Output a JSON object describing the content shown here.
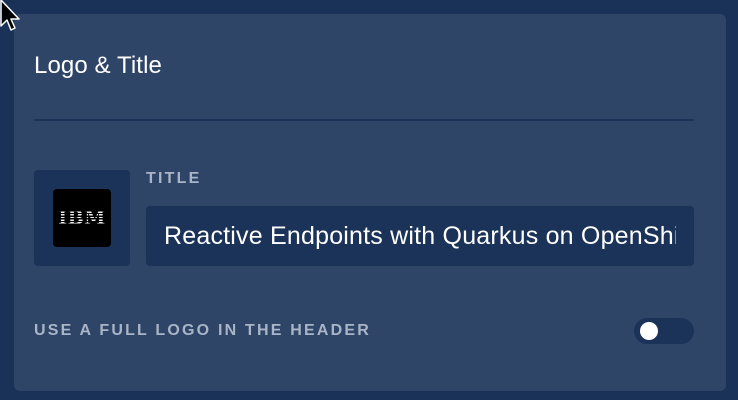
{
  "panel": {
    "title": "Logo & Title"
  },
  "logo": {
    "icon": "ibm-logo",
    "text": "IBM"
  },
  "title_field": {
    "label": "TITLE",
    "value": "Reactive Endpoints with Quarkus on OpenShift"
  },
  "full_logo_toggle": {
    "label": "USE A FULL LOGO IN THE HEADER",
    "enabled": false
  },
  "colors": {
    "background": "#1b3258",
    "panel": "#2f4568",
    "field_background": "#1b3358",
    "label": "#a9b4c6",
    "text": "#ffffff"
  }
}
